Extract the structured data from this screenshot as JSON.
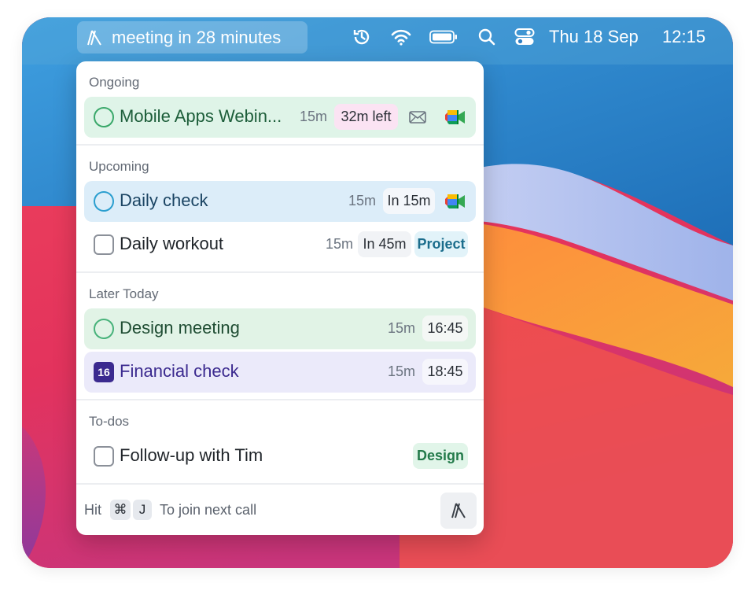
{
  "menubar": {
    "app_status": "meeting in 28 minutes",
    "date": "Thu 18 Sep",
    "time": "12:15",
    "icons": [
      "app-logo-icon",
      "time-machine-icon",
      "wifi-icon",
      "battery-icon",
      "search-icon",
      "control-center-icon"
    ]
  },
  "sections": {
    "ongoing": "Ongoing",
    "upcoming": "Upcoming",
    "later_today": "Later Today",
    "todos": "To-dos"
  },
  "events": {
    "mobile_apps": {
      "title": "Mobile Apps Webin...",
      "duration": "15m",
      "status": "32m left",
      "bg": "#dff4e8",
      "title_color": "#1d5e3a"
    },
    "daily_check": {
      "title": "Daily check",
      "duration": "15m",
      "status": "In 15m",
      "bg": "#dcedf9",
      "title_color": "#1a4463"
    },
    "daily_workout": {
      "title": "Daily workout",
      "duration": "15m",
      "status": "In 45m",
      "tag": "Project",
      "tag_color": "#1b6d8c"
    },
    "design_meeting": {
      "title": "Design meeting",
      "duration": "15m",
      "time": "16:45",
      "bg": "#e1f3e6",
      "title_color": "#1f4d33"
    },
    "financial_check": {
      "title": "Financial check",
      "duration": "15m",
      "time": "18:45",
      "day_badge": "16",
      "bg": "#ebeafa",
      "title_color": "#3b2a8f"
    },
    "follow_up": {
      "title": "Follow-up with Tim",
      "tag": "Design",
      "tag_color": "#237a4a"
    }
  },
  "footer": {
    "prefix": "Hit",
    "key1": "⌘",
    "key2": "J",
    "suffix": "To join next call"
  }
}
